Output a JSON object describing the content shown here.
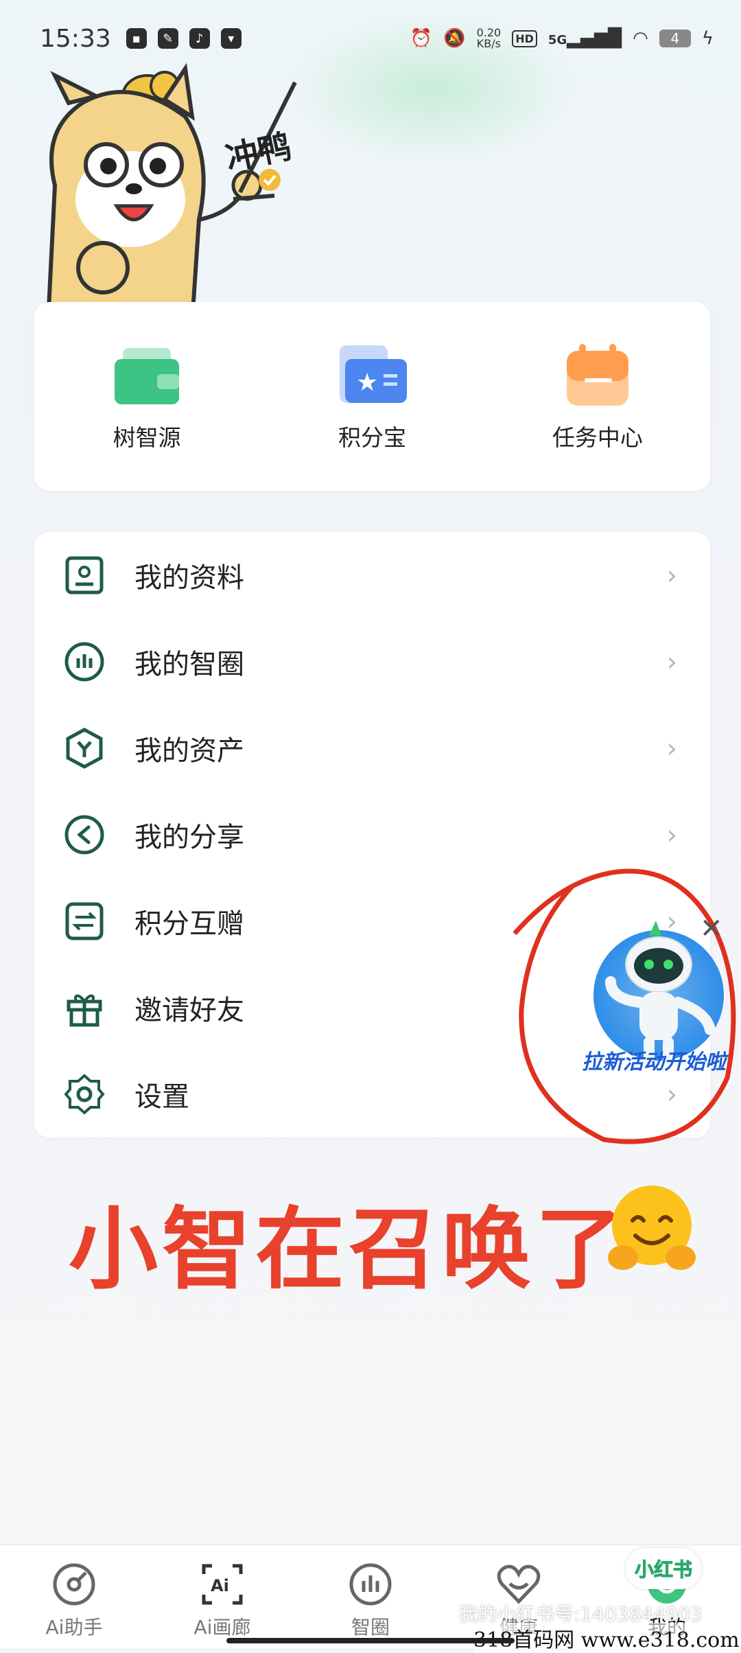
{
  "status_bar": {
    "time": "15:33",
    "net_speed_value": "0.20",
    "net_speed_unit": "KB/s",
    "hd_label": "HD",
    "signal_label": "5G",
    "battery": "4"
  },
  "mascot": {
    "sticker_text": "冲鸭"
  },
  "quick_actions": [
    {
      "label": "树智源",
      "icon": "wallet-icon"
    },
    {
      "label": "积分宝",
      "icon": "card-star-icon"
    },
    {
      "label": "任务中心",
      "icon": "calendar-task-icon"
    }
  ],
  "menu": [
    {
      "label": "我的资料",
      "icon": "profile-card-icon"
    },
    {
      "label": "我的智圈",
      "icon": "circle-bars-icon"
    },
    {
      "label": "我的资产",
      "icon": "hexagon-asset-icon"
    },
    {
      "label": "我的分享",
      "icon": "share-icon"
    },
    {
      "label": "积分互赠",
      "icon": "transfer-icon"
    },
    {
      "label": "邀请好友",
      "icon": "gift-icon"
    },
    {
      "label": "设置",
      "icon": "gear-icon"
    }
  ],
  "promo": {
    "text": "拉新活动开始啦"
  },
  "caption": {
    "text": "小智在召唤了"
  },
  "tabbar": [
    {
      "label": "Ai助手",
      "icon": "ai-assistant-icon",
      "active": false
    },
    {
      "label": "Ai画廊",
      "icon": "ai-gallery-icon",
      "active": false
    },
    {
      "label": "智圈",
      "icon": "circle-bars-icon",
      "active": false
    },
    {
      "label": "健康",
      "icon": "heart-icon",
      "active": false
    },
    {
      "label": "我的",
      "icon": "profile-icon",
      "active": true
    }
  ],
  "watermarks": {
    "xhs_id": "我的小红书号:1403844903",
    "site": "318首码网  www.e318.com",
    "xhs_badge": "小红书"
  },
  "colors": {
    "brand_green": "#1f5c45",
    "caption_red": "#e8412c",
    "promo_blue": "#1b5bd6"
  }
}
